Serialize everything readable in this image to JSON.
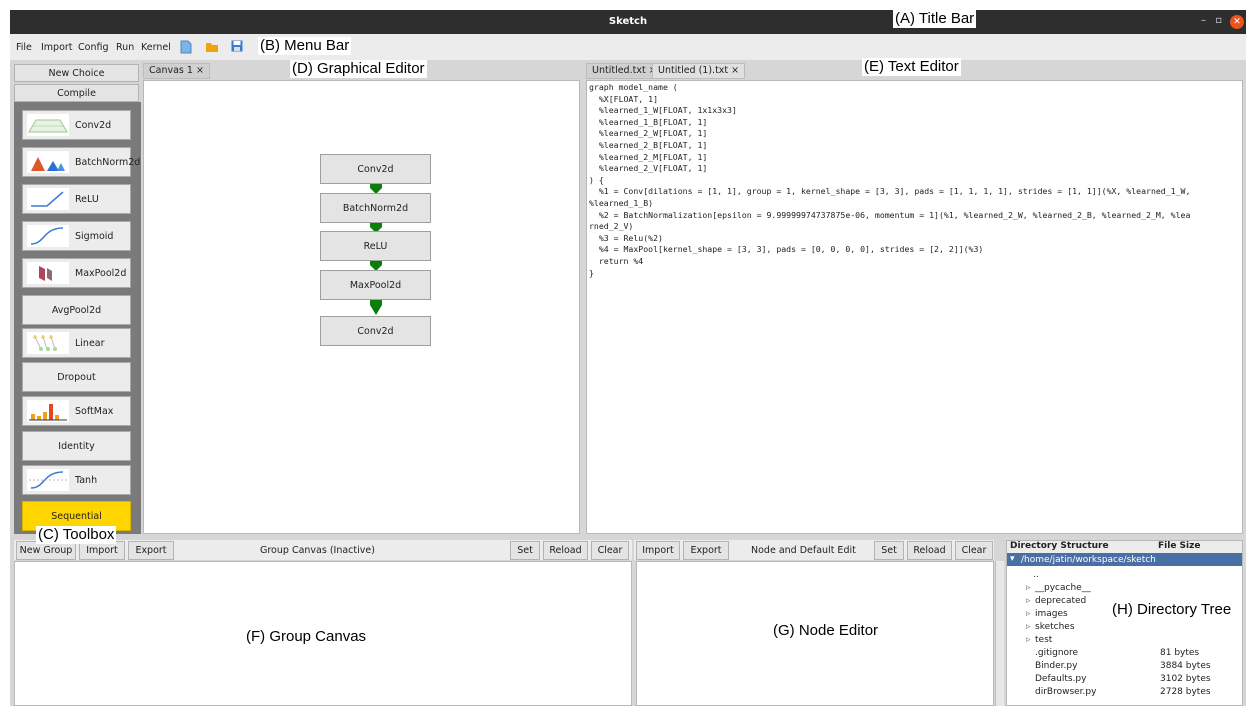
{
  "title_bar": {
    "title": "Sketch",
    "minimize": "–",
    "maximize": "▫",
    "close": "✕"
  },
  "menu": {
    "items": [
      "File",
      "Import",
      "Config",
      "Run",
      "Kernel"
    ],
    "icons": [
      "file-new-icon",
      "folder-open-icon",
      "save-icon"
    ]
  },
  "annotations": {
    "title_bar": "(A) Title Bar",
    "menu_bar": "(B) Menu Bar",
    "toolbox": "(C) Toolbox",
    "graphical_editor": "(D) Graphical Editor",
    "text_editor": "(E) Text Editor",
    "group_canvas": "(F) Group Canvas",
    "node_editor": "(G) Node Editor",
    "directory_tree": "(H) Directory Tree"
  },
  "toolbox": {
    "new_choice": "New Choice",
    "compile": "Compile",
    "tools": [
      "Conv2d",
      "BatchNorm2d",
      "ReLU",
      "Sigmoid",
      "MaxPool2d",
      "AvgPool2d",
      "Linear",
      "Dropout",
      "SoftMax",
      "Identity",
      "Tanh",
      "Sequential"
    ],
    "highlight_color": "#ffd500"
  },
  "graphical_editor": {
    "tab": "Canvas 1 ×",
    "nodes": [
      "Conv2d",
      "BatchNorm2d",
      "ReLU",
      "MaxPool2d",
      "Conv2d"
    ],
    "edge_color": "#0a7d0a"
  },
  "text_editor": {
    "tabs": [
      "Untitled.txt ×",
      "Untitled (1).txt ×"
    ],
    "code": [
      "graph model_name (",
      "  %X[FLOAT, 1]",
      "  %learned_1_W[FLOAT, 1x1x3x3]",
      "  %learned_1_B[FLOAT, 1]",
      "  %learned_2_W[FLOAT, 1]",
      "  %learned_2_B[FLOAT, 1]",
      "  %learned_2_M[FLOAT, 1]",
      "  %learned_2_V[FLOAT, 1]",
      ") {",
      "  %1 = Conv[dilations = [1, 1], group = 1, kernel_shape = [3, 3], pads = [1, 1, 1, 1], strides = [1, 1]](%X, %learned_1_W,",
      "%learned_1_B)",
      "  %2 = BatchNormalization[epsilon = 9.99999974737875e-06, momentum = 1](%1, %learned_2_W, %learned_2_B, %learned_2_M, %lea",
      "rned_2_V)",
      "  %3 = Relu(%2)",
      "  %4 = MaxPool[kernel_shape = [3, 3], pads = [0, 0, 0, 0], strides = [2, 2]](%3)",
      "  return %4",
      "}"
    ]
  },
  "group_canvas": {
    "new_group": "New Group",
    "import": "Import",
    "export": "Export",
    "title": "Group Canvas (Inactive)",
    "set": "Set",
    "reload": "Reload",
    "clear": "Clear"
  },
  "node_editor": {
    "import": "Import",
    "export": "Export",
    "title": "Node and Default Edit",
    "set": "Set",
    "reload": "Reload",
    "clear": "Clear"
  },
  "directory": {
    "col_structure": "Directory Structure",
    "col_size": "File Size",
    "root": "/home/jatin/workspace/sketch",
    "entries": [
      {
        "name": "..",
        "size": "",
        "folder": false
      },
      {
        "name": "__pycache__",
        "size": "",
        "folder": true
      },
      {
        "name": "deprecated",
        "size": "",
        "folder": true
      },
      {
        "name": "images",
        "size": "",
        "folder": true
      },
      {
        "name": "sketches",
        "size": "",
        "folder": true
      },
      {
        "name": "test",
        "size": "",
        "folder": true
      },
      {
        "name": ".gitignore",
        "size": "81 bytes",
        "folder": false
      },
      {
        "name": "Binder.py",
        "size": "3884 bytes",
        "folder": false
      },
      {
        "name": "Defaults.py",
        "size": "3102 bytes",
        "folder": false
      },
      {
        "name": "dirBrowser.py",
        "size": "2728 bytes",
        "folder": false
      }
    ]
  }
}
